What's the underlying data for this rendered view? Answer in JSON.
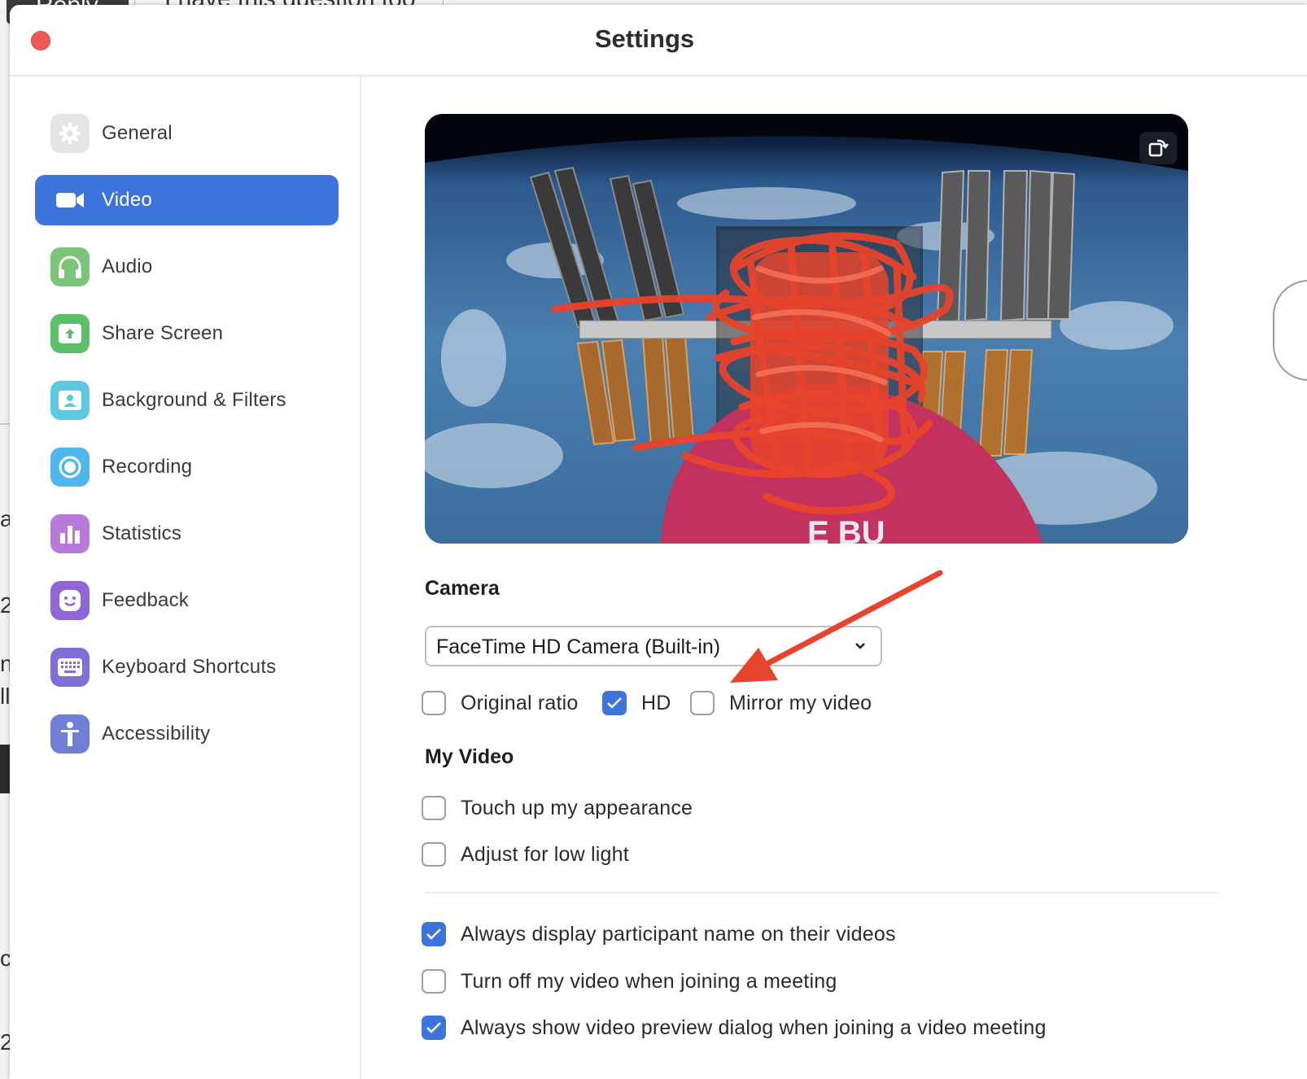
{
  "background_page": {
    "reply_label": "Reply",
    "question_label": "I have this question too",
    "edge_letters": [
      "a",
      "2",
      "n",
      "ll",
      "c",
      "2"
    ]
  },
  "window": {
    "title": "Settings"
  },
  "sidebar": {
    "items": [
      {
        "label": "General",
        "icon": "gear-icon",
        "color": "#e4e4e6",
        "active": false
      },
      {
        "label": "Video",
        "icon": "video-camera-icon",
        "color": "#3d74dc",
        "active": true
      },
      {
        "label": "Audio",
        "icon": "headphones-icon",
        "color": "#7cc47a",
        "active": false
      },
      {
        "label": "Share Screen",
        "icon": "share-screen-icon",
        "color": "#5cbf6a",
        "active": false
      },
      {
        "label": "Background & Filters",
        "icon": "person-background-icon",
        "color": "#5ec8e0",
        "active": false
      },
      {
        "label": "Recording",
        "icon": "record-icon",
        "color": "#4fb6ee",
        "active": false
      },
      {
        "label": "Statistics",
        "icon": "bar-chart-icon",
        "color": "#b77ad7",
        "active": false
      },
      {
        "label": "Feedback",
        "icon": "smiley-icon",
        "color": "#8f66d6",
        "active": false
      },
      {
        "label": "Keyboard Shortcuts",
        "icon": "keyboard-icon",
        "color": "#7f6ed8",
        "active": false
      },
      {
        "label": "Accessibility",
        "icon": "accessibility-icon",
        "color": "#6f7fd6",
        "active": false
      }
    ]
  },
  "content": {
    "camera": {
      "section_title": "Camera",
      "selected_camera": "FaceTime HD Camera (Built-in)",
      "options": [
        {
          "label": "Original ratio",
          "checked": false
        },
        {
          "label": "HD",
          "checked": true
        },
        {
          "label": "Mirror my video",
          "checked": false
        }
      ]
    },
    "my_video": {
      "section_title": "My Video",
      "options": [
        {
          "label": "Touch up my appearance",
          "checked": false
        },
        {
          "label": "Adjust for low light",
          "checked": false
        }
      ]
    },
    "general_video_options": [
      {
        "label": "Always display participant name on their videos",
        "checked": true
      },
      {
        "label": "Turn off my video when joining a meeting",
        "checked": false
      },
      {
        "label": "Always show video preview dialog when joining a video meeting",
        "checked": true
      }
    ]
  },
  "colors": {
    "accent": "#3d74dc",
    "close_button": "#ee5a52",
    "annotation": "#e8432c"
  }
}
